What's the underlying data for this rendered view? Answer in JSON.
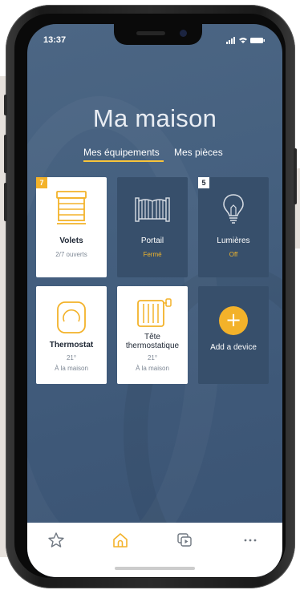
{
  "status_bar": {
    "time": "13:37"
  },
  "header": {
    "title": "Ma maison"
  },
  "tabs": [
    {
      "label": "Mes équipements",
      "active": true
    },
    {
      "label": "Mes pièces",
      "active": false
    }
  ],
  "tiles": [
    {
      "name": "Volets",
      "status": "2/7 ouverts",
      "badge": "7",
      "style": "white",
      "icon": "shutter-icon"
    },
    {
      "name": "Portail",
      "status": "Fermé",
      "style": "dark",
      "icon": "gate-icon"
    },
    {
      "name": "Lumières",
      "status": "Off",
      "badge": "5",
      "style": "dark",
      "icon": "lightbulb-icon"
    },
    {
      "name": "Thermostat",
      "temperature": "21°",
      "status": "À la maison",
      "style": "white",
      "icon": "thermostat-icon"
    },
    {
      "name": "Tête thermostatique",
      "temperature": "21°",
      "status": "À la maison",
      "style": "white",
      "icon": "radiator-icon"
    },
    {
      "name": "Add a device",
      "style": "dark",
      "icon": "plus-icon"
    }
  ],
  "bottom_nav": [
    {
      "icon": "star-icon",
      "active": false
    },
    {
      "icon": "home-icon",
      "active": true
    },
    {
      "icon": "scenes-icon",
      "active": false
    },
    {
      "icon": "more-icon",
      "active": false
    }
  ],
  "colors": {
    "accent": "#f3b22a",
    "background": "#45607f",
    "tile_dark": "#374f6b"
  }
}
